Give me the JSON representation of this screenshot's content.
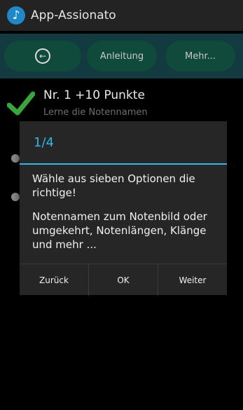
{
  "app": {
    "title": "App-Assionato",
    "icon": "music-note-icon"
  },
  "toolbar": {
    "back_icon": "back-arrow-icon",
    "anleitung_label": "Anleitung",
    "more_label": "Mehr..."
  },
  "list": {
    "items": [
      {
        "title": "Nr. 1 +10 Punkte",
        "subtitle": "Lerne die Notennamen",
        "icon": "checkmark-icon"
      }
    ]
  },
  "dialog": {
    "title": "1/4",
    "paragraphs": [
      "Wähle aus sieben Optionen die richtige!",
      "Notennamen zum Notenbild oder umgekehrt, Notenlängen, Klänge und mehr ..."
    ],
    "buttons": {
      "back": "Zurück",
      "ok": "OK",
      "next": "Weiter"
    }
  },
  "colors": {
    "accent": "#33b5e5",
    "toolbar_bg": "#123a40",
    "button_bg": "#0f4a3a",
    "check_green": "#3aa53a"
  }
}
